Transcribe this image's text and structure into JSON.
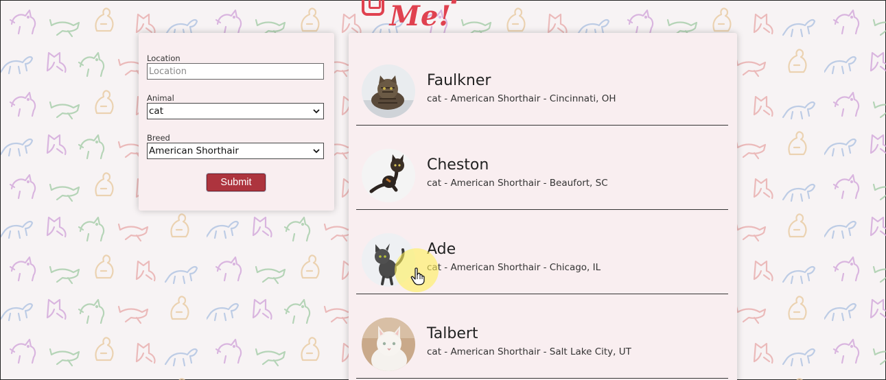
{
  "app": {
    "logo_text": "Adopt Me!",
    "brand_color": "#e0414f"
  },
  "search": {
    "location_label": "Location",
    "location_placeholder": "Location",
    "location_value": "",
    "animal_label": "Animal",
    "animal_value": "cat",
    "breed_label": "Breed",
    "breed_value": "American Shorthair",
    "submit_label": "Submit",
    "submit_color": "#ad343e"
  },
  "results": [
    {
      "name": "Faulkner",
      "info": "cat - American Shorthair - Cincinnati, OH"
    },
    {
      "name": "Cheston",
      "info": "cat - American Shorthair - Beaufort, SC"
    },
    {
      "name": "Ade",
      "info": "cat - American Shorthair - Chicago, IL"
    },
    {
      "name": "Talbert",
      "info": "cat - American Shorthair - Salt Lake City, UT"
    }
  ],
  "icons": {
    "cursor": "hand-pointer-icon",
    "select_arrow": "chevron-down-icon"
  }
}
